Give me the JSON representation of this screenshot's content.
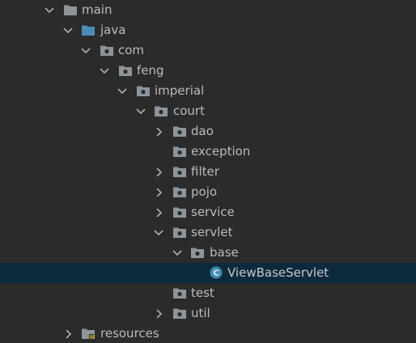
{
  "project_tree": {
    "nodes": [
      {
        "label": "main",
        "depth": 0,
        "expanded": true,
        "icon": "folder-icon"
      },
      {
        "label": "java",
        "depth": 1,
        "expanded": true,
        "icon": "source-folder-icon"
      },
      {
        "label": "com",
        "depth": 2,
        "expanded": true,
        "icon": "package-icon"
      },
      {
        "label": "feng",
        "depth": 3,
        "expanded": true,
        "icon": "package-icon"
      },
      {
        "label": "imperial",
        "depth": 4,
        "expanded": true,
        "icon": "package-icon"
      },
      {
        "label": "court",
        "depth": 5,
        "expanded": true,
        "icon": "package-icon"
      },
      {
        "label": "dao",
        "depth": 6,
        "expanded": false,
        "icon": "package-icon"
      },
      {
        "label": "exception",
        "depth": 6,
        "expanded": null,
        "icon": "package-icon"
      },
      {
        "label": "filter",
        "depth": 6,
        "expanded": false,
        "icon": "package-icon"
      },
      {
        "label": "pojo",
        "depth": 6,
        "expanded": false,
        "icon": "package-icon"
      },
      {
        "label": "service",
        "depth": 6,
        "expanded": false,
        "icon": "package-icon"
      },
      {
        "label": "servlet",
        "depth": 6,
        "expanded": true,
        "icon": "package-icon"
      },
      {
        "label": "base",
        "depth": 7,
        "expanded": true,
        "icon": "package-icon"
      },
      {
        "label": "ViewBaseServlet",
        "depth": 8,
        "expanded": null,
        "icon": "java-class-icon",
        "selected": true
      },
      {
        "label": "test",
        "depth": 6,
        "expanded": null,
        "icon": "package-icon"
      },
      {
        "label": "util",
        "depth": 6,
        "expanded": false,
        "icon": "package-icon"
      },
      {
        "label": "resources",
        "depth": 1,
        "expanded": false,
        "icon": "resources-folder-icon"
      }
    ]
  },
  "colors": {
    "background": "#2b2b2b",
    "text": "#bbbbbb",
    "selection": "#0d293e",
    "folder": "#8d949a",
    "source_folder": "#4a8cb4",
    "class_icon": "#3f8fb0",
    "resources_accent": "#c9a227"
  }
}
